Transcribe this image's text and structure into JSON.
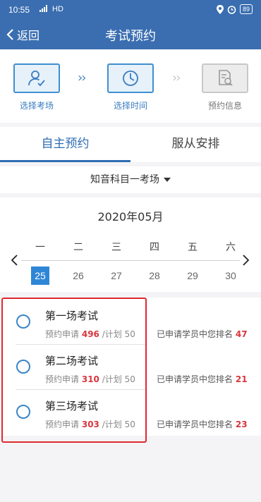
{
  "status_bar": {
    "time": "10:55",
    "network": "HD",
    "battery": "89"
  },
  "nav": {
    "back_label": "返回",
    "title": "考试预约"
  },
  "steps": [
    {
      "label": "选择考场",
      "icon": "user-check-icon"
    },
    {
      "label": "选择时间",
      "icon": "clock-icon"
    },
    {
      "label": "预约信息",
      "icon": "document-search-icon"
    }
  ],
  "tabs": [
    {
      "label": "自主预约"
    },
    {
      "label": "服从安排"
    }
  ],
  "subject": {
    "label": "知音科目一考场"
  },
  "calendar": {
    "month": "2020年05月",
    "weekdays": [
      "一",
      "二",
      "三",
      "四",
      "五",
      "六"
    ],
    "dates": [
      "25",
      "26",
      "27",
      "28",
      "29",
      "30"
    ],
    "selected": "25"
  },
  "sessions": [
    {
      "name": "第一场考试",
      "apply_label": "预约申请",
      "applied": "496",
      "plan_label": "/计划",
      "plan": "50",
      "rank_label": "已申请学员中您排名",
      "rank": "47"
    },
    {
      "name": "第二场考试",
      "apply_label": "预约申请",
      "applied": "310",
      "plan_label": "/计划",
      "plan": "50",
      "rank_label": "已申请学员中您排名",
      "rank": "21"
    },
    {
      "name": "第三场考试",
      "apply_label": "预约申请",
      "applied": "303",
      "plan_label": "/计划",
      "plan": "50",
      "rank_label": "已申请学员中您排名",
      "rank": "23"
    }
  ],
  "colors": {
    "primary": "#3a6eb0",
    "accent": "#2f86d6",
    "highlight": "#d9363e",
    "frame": "#e0282e"
  }
}
